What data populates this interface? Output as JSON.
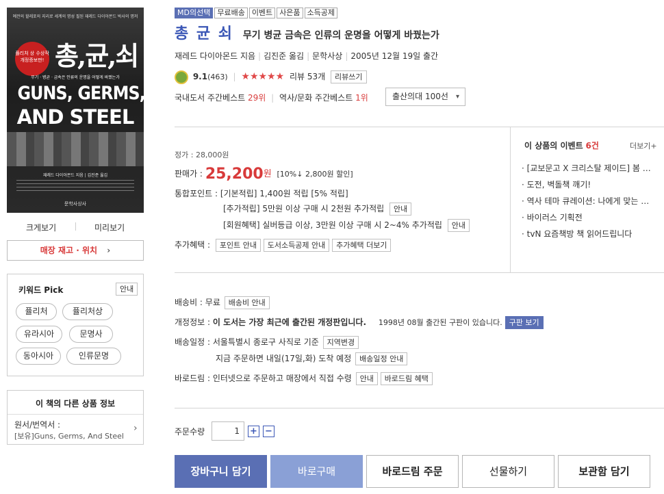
{
  "cover": {
    "top_text": "예전의 할레포의 지리로 세계의 명성 필된 재레드 다이아몬드 박사의 명저",
    "badge": "퓰리처 상 수상작 개정증보판!",
    "title_ko": "총,균,쇠",
    "subtitle": "무기 · 병균 · 금속은 인류의 운명을 어떻게 바꿨는가",
    "title_en_1": "GUNS, GERMS,",
    "title_en_2": "AND STEEL",
    "author": "재레드 다이아몬드 지음 | 김진준 옮김",
    "publisher": "문학사상사"
  },
  "left": {
    "zoom_label": "크게보기",
    "preview_label": "미리보기",
    "store_stock_label": "매장 재고 · 위치",
    "keyword_title": "키워드 Pick",
    "keyword_info": "안내",
    "keywords": [
      "퓰리처",
      "퓰리처상",
      "유라시아",
      "문명사",
      "동아시아",
      "인류문명"
    ],
    "other_title": "이 책의 다른 상품 정보",
    "other_label": "원서/번역서 :",
    "other_value": "[보유]Guns, Germs, And Steel"
  },
  "tags": [
    "MD의선택",
    "무료배송",
    "이벤트",
    "사은품",
    "소득공제"
  ],
  "title": "총 균 쇠",
  "subtitle": "무기 병균 금속은 인류의 운명을 어떻게 바꿨는가",
  "author": "재레드 다이아몬드 지음",
  "translator": "김진준 옮김",
  "publisher": "문학사상",
  "pub_date": "2005년 12월 19일 출간",
  "rating": "9.1",
  "rating_count": "(463)",
  "stars": "★★★★★",
  "review_label": "리뷰",
  "review_count": "53개",
  "review_write": "리뷰쓰기",
  "best_domestic_label": "국내도서 주간베스트",
  "best_domestic_rank": "29위",
  "best_history_label": "역사/문화 주간베스트",
  "best_history_rank": "1위",
  "dropdown": "출산의대 100선",
  "list_price": "정가 : 28,000원",
  "sale_label": "판매가 :",
  "sale_price": "25,200",
  "sale_unit": "원",
  "discount": "[10%↓ 2,800원 할인]",
  "points": {
    "label": "통합포인트 :",
    "basic": "[기본적립] 1,400원 적립 [5% 적립]",
    "extra": "[추가적립] 5만원 이상 구매 시 2천원 추가적립",
    "extra_btn": "안내",
    "member": "[회원혜택] 실버등급 이상, 3만원 이상 구매 시 2~4% 추가적립",
    "member_btn": "안내"
  },
  "benefit": {
    "label": "추가혜택 :",
    "buttons": [
      "포인트 안내",
      "도서소득공제 안내",
      "추가혜택 더보기"
    ]
  },
  "events": {
    "title": "이 상품의 이벤트",
    "count": "6건",
    "more": "더보기+",
    "items": [
      "[교보문고 X 크리스탈 제이드] 봄 …",
      "도전, 벽돌책 깨기!",
      "역사 테마 큐레이션: 나에게 맞는 …",
      "바이러스 기획전",
      "tvN 요즘책방 책 읽어드립니다"
    ]
  },
  "shipping": {
    "fee_label": "배송비 : 무료",
    "fee_btn": "배송비 안내",
    "revision_label": "개정정보 :",
    "revision_text": "이 도서는 가장 최근에 출간된 개정판입니다.",
    "old_text": "1998년 08월 출간된 구판이 있습니다.",
    "old_btn": "구판 보기",
    "schedule_label": "배송일정 : 서울특별시 종로구 사직로 기준",
    "region_btn": "지역변경",
    "schedule_text": "지금 주문하면 내일(17일,화) 도착 예정",
    "schedule_btn": "배송일정 안내",
    "baro_label": "바로드림 : 인터넷으로 주문하고 매장에서 직접 수령",
    "baro_btn1": "안내",
    "baro_btn2": "바로드림 혜택"
  },
  "order": {
    "qty_label": "주문수량",
    "qty": "1",
    "plus": "+",
    "minus": "−"
  },
  "actions": [
    "장바구니 담기",
    "바로구매",
    "바로드림 주문",
    "선물하기",
    "보관함 담기"
  ],
  "colors": {
    "accent": "#5a6fb4",
    "price": "#d83a3a",
    "buy": "#8aa0d6"
  }
}
